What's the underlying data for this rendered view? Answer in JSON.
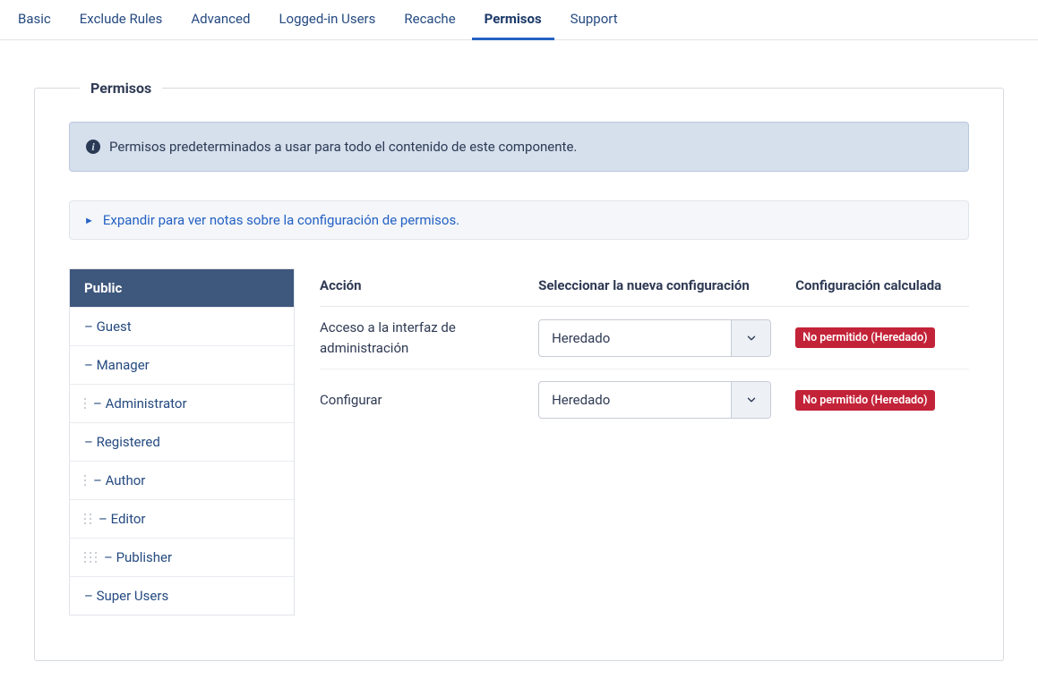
{
  "tabs": [
    {
      "label": "Basic"
    },
    {
      "label": "Exclude Rules"
    },
    {
      "label": "Advanced"
    },
    {
      "label": "Logged-in Users"
    },
    {
      "label": "Recache"
    },
    {
      "label": "Permisos",
      "active": true
    },
    {
      "label": "Support"
    }
  ],
  "fieldset_title": "Permisos",
  "info_banner": "Permisos predeterminados a usar para todo el contenido de este componente.",
  "expand_text": "Expandir para ver notas sobre la configuración de permisos.",
  "groups": [
    {
      "label": "Public",
      "level": 0,
      "active": true
    },
    {
      "label": "Guest",
      "level": 1
    },
    {
      "label": "Manager",
      "level": 1
    },
    {
      "label": "Administrator",
      "level": 2
    },
    {
      "label": "Registered",
      "level": 1
    },
    {
      "label": "Author",
      "level": 2
    },
    {
      "label": "Editor",
      "level": 3
    },
    {
      "label": "Publisher",
      "level": 4
    },
    {
      "label": "Super Users",
      "level": 1
    }
  ],
  "table": {
    "headers": {
      "action": "Acción",
      "setting": "Seleccionar la nueva configuración",
      "calculated": "Configuración calculada"
    },
    "rows": [
      {
        "action": "Acceso a la interfaz de administración",
        "setting": "Heredado",
        "calculated": "No permitido (Heredado)"
      },
      {
        "action": "Configurar",
        "setting": "Heredado",
        "calculated": "No permitido (Heredado)"
      }
    ]
  }
}
